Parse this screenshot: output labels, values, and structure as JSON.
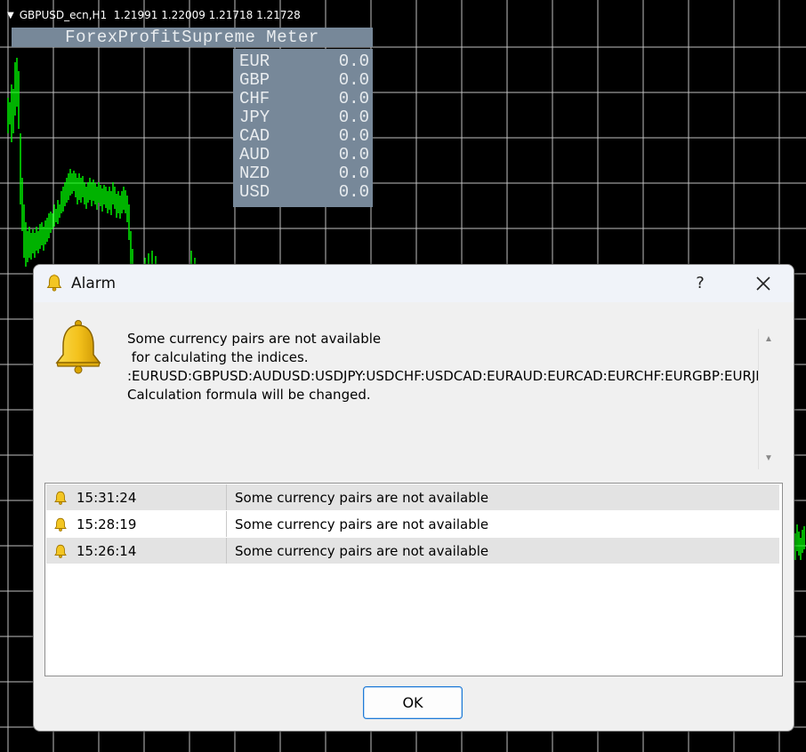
{
  "chart": {
    "symbol_info": "GBPUSD_ecn,H1  1.21991 1.22009 1.21718 1.21728",
    "grid_color": "#c0c0c0",
    "candle_color": "#00ff00"
  },
  "meter": {
    "title": "ForexProfitSupreme Meter",
    "panel_color": "#778899",
    "rows": [
      {
        "currency": "EUR",
        "value": "0.0"
      },
      {
        "currency": "GBP",
        "value": "0.0"
      },
      {
        "currency": "CHF",
        "value": "0.0"
      },
      {
        "currency": "JPY",
        "value": "0.0"
      },
      {
        "currency": "CAD",
        "value": "0.0"
      },
      {
        "currency": "AUD",
        "value": "0.0"
      },
      {
        "currency": "NZD",
        "value": "0.0"
      },
      {
        "currency": "USD",
        "value": "0.0"
      }
    ]
  },
  "dialog": {
    "title": "Alarm",
    "title_icon": "bell-icon",
    "help_label": "?",
    "close_icon": "close-icon",
    "message_lines": [
      "Some currency pairs are not available",
      " for calculating the indices.",
      ":EURUSD:GBPUSD:AUDUSD:USDJPY:USDCHF:USDCAD:EURAUD:EURCAD:EURCHF:EURGBP:EURJPY:",
      "Calculation formula will be changed."
    ],
    "log": [
      {
        "time": "15:31:24",
        "message": "Some currency pairs are not available"
      },
      {
        "time": "15:28:19",
        "message": "Some currency pairs are not available"
      },
      {
        "time": "15:26:14",
        "message": "Some currency pairs are not available"
      }
    ],
    "ok_label": "OK",
    "accent_color": "#1f7ad6"
  }
}
